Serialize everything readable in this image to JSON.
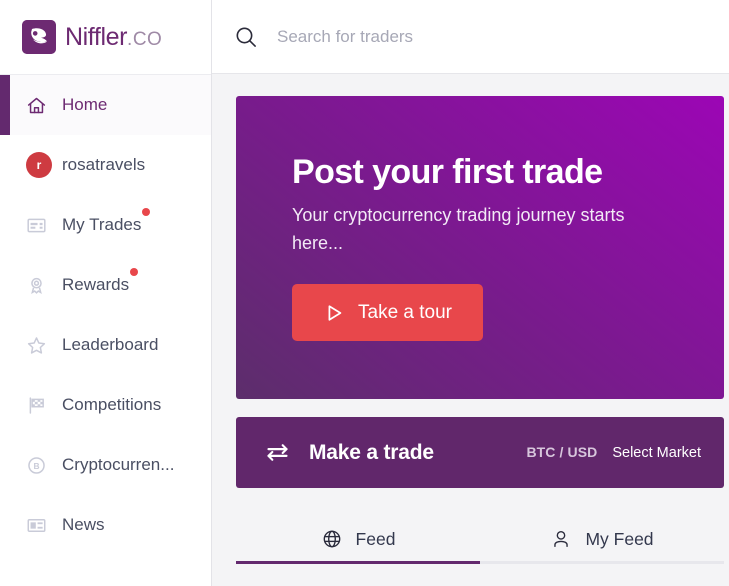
{
  "brand": {
    "name": "Niffler",
    "suffix": ".CO",
    "logo_icon": "niffler-logo-icon",
    "color": "#6d2a72"
  },
  "search": {
    "icon": "search-icon",
    "placeholder": "Search for traders",
    "value": ""
  },
  "sidebar": {
    "items": [
      {
        "label": "Home",
        "icon": "home-icon",
        "active": true,
        "badge": false
      },
      {
        "label": "rosatravels",
        "icon": "avatar",
        "active": false,
        "badge": false,
        "avatar_initial": "r",
        "avatar_color": "#ce3b41"
      },
      {
        "label": "My Trades",
        "icon": "card-icon",
        "active": false,
        "badge": true
      },
      {
        "label": "Rewards",
        "icon": "award-icon",
        "active": false,
        "badge": true
      },
      {
        "label": "Leaderboard",
        "icon": "star-icon",
        "active": false,
        "badge": false
      },
      {
        "label": "Competitions",
        "icon": "flag-icon",
        "active": false,
        "badge": false
      },
      {
        "label": "Cryptocurren...",
        "icon": "bitcoin-icon",
        "active": false,
        "badge": false
      },
      {
        "label": "News",
        "icon": "newspaper-icon",
        "active": false,
        "badge": false
      }
    ]
  },
  "hero": {
    "title": "Post your first trade",
    "subtitle": "Your cryptocurrency trading journey starts here...",
    "button_label": "Take a tour",
    "button_icon": "play-icon",
    "button_color": "#e8474b",
    "gradient_from": "#5c2e6b",
    "gradient_to": "#9c06b5"
  },
  "trade_bar": {
    "icon": "swap-arrows-icon",
    "title": "Make a trade",
    "pair": "BTC / USD",
    "select_market_label": "Select Market",
    "background": "#61276b"
  },
  "tabs": [
    {
      "label": "Feed",
      "icon": "globe-icon",
      "active": true
    },
    {
      "label": "My Feed",
      "icon": "person-icon",
      "active": false
    }
  ],
  "accent_color": "#63296e"
}
